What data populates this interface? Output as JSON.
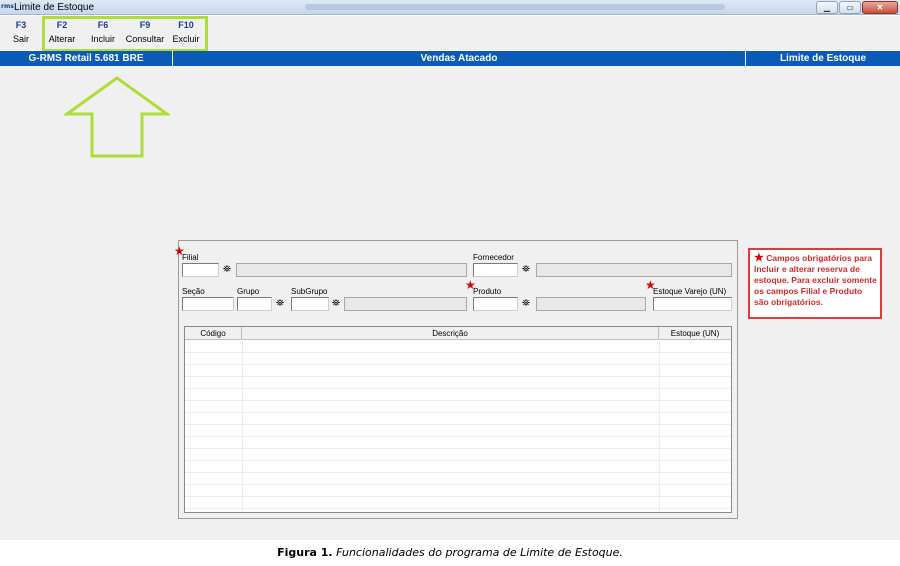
{
  "window": {
    "app_logo": "rms",
    "title": "Limite de Estoque",
    "controls": [
      "minimize",
      "maximize",
      "close"
    ]
  },
  "toolbar": {
    "keys": [
      {
        "key": "F3",
        "label": "Sair"
      },
      {
        "key": "F2",
        "label": "Alterar"
      },
      {
        "key": "F6",
        "label": "Incluir"
      },
      {
        "key": "F9",
        "label": "Consultar"
      },
      {
        "key": "F10",
        "label": "Excluir"
      }
    ],
    "highlight_color": "#aedc3a"
  },
  "header": {
    "left": "G-RMS Retail 5.681 BRE",
    "center": "Vendas Atacado",
    "right": "Limite de Estoque",
    "color": "#0a5bb5"
  },
  "form": {
    "filial_label": "Filial",
    "fornecedor_label": "Fornecedor",
    "secao_label": "Seção",
    "grupo_label": "Grupo",
    "subgrupo_label": "SubGrupo",
    "produto_label": "Produto",
    "estoque_varejo_label": "Estoque Varejo (UN)",
    "filial_value": "",
    "fornecedor_value": "",
    "secao_value": "",
    "grupo_value": "",
    "subgrupo_value": "",
    "produto_value": "",
    "estoque_varejo_value": ""
  },
  "grid": {
    "columns": [
      "Código",
      "Descrição",
      "Estoque (UN)"
    ],
    "rows": []
  },
  "note": {
    "text": "Campos obrigatórios para Incluir e alterar reserva de estoque. Para excluir somente os campos Filial e Produto são obrigatórios.",
    "color": "#e23a3a"
  },
  "caption": {
    "label": "Figura 1.",
    "text": "Funcionalidades do programa de Limite de Estoque."
  },
  "annotation": {
    "arrow_color": "#aedc3a"
  }
}
